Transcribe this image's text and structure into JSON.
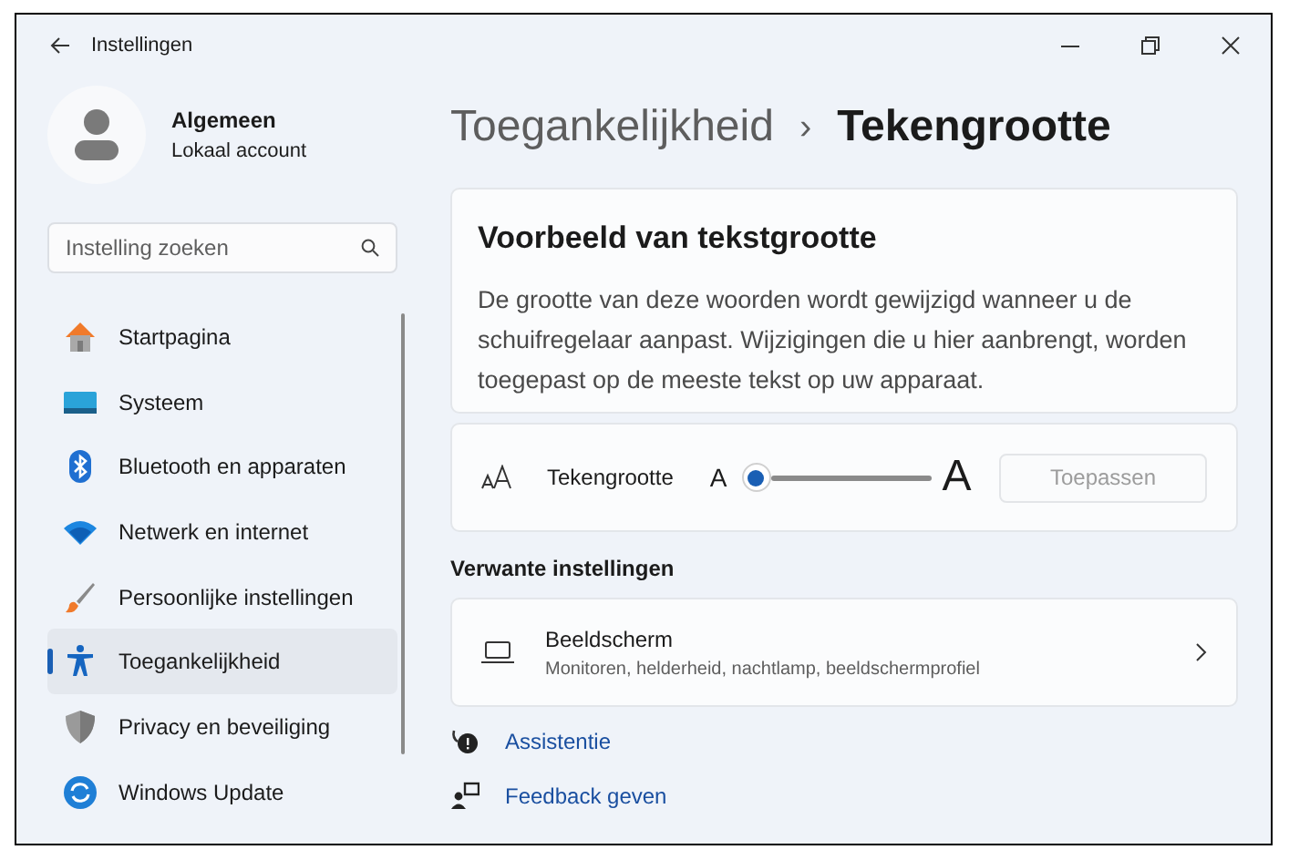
{
  "window": {
    "title": "Instellingen"
  },
  "account": {
    "name": "Algemeen",
    "type": "Lokaal account"
  },
  "search": {
    "placeholder": "Instelling zoeken"
  },
  "sidebar": {
    "items": [
      {
        "label": "Startpagina",
        "kind": "home",
        "selected": false
      },
      {
        "label": "Systeem",
        "kind": "system",
        "selected": false
      },
      {
        "label": "Bluetooth en apparaten",
        "kind": "bluetooth",
        "selected": false
      },
      {
        "label": "Netwerk en internet",
        "kind": "wifi",
        "selected": false
      },
      {
        "label": "Persoonlijke instellingen",
        "kind": "brush",
        "selected": false
      },
      {
        "label": "Toegankelijkheid",
        "kind": "accessibility",
        "selected": true
      },
      {
        "label": "Privacy en beveiliging",
        "kind": "shield",
        "selected": false
      },
      {
        "label": "Windows Update",
        "kind": "update",
        "selected": false
      }
    ]
  },
  "breadcrumb": {
    "parent": "Toegankelijkheid",
    "separator": "›",
    "current": "Tekengrootte"
  },
  "preview": {
    "title": "Voorbeeld van tekstgrootte",
    "text": "De grootte van deze woorden wordt gewijzigd wanneer u de schuifregelaar aanpast. Wijzigingen die u hier aanbrengt, worden toegepast op de meeste tekst op uw apparaat."
  },
  "text_size": {
    "label": "Tekengrootte",
    "small_label": "A",
    "large_label": "A",
    "apply_button": {
      "label": "Toepassen",
      "disabled": true
    }
  },
  "related": {
    "heading": "Verwante instellingen",
    "items": [
      {
        "title": "Beeldscherm",
        "description": "Monitoren, helderheid, nachtlamp, beeldschermprofiel"
      }
    ]
  },
  "links": [
    {
      "label": "Assistentie",
      "kind": "help"
    },
    {
      "label": "Feedback geven",
      "kind": "feedback"
    }
  ]
}
